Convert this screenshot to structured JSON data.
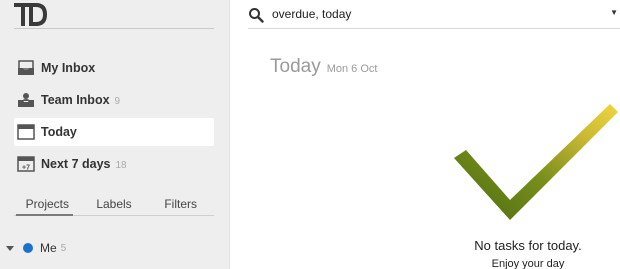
{
  "app": {
    "logo_text": "TD"
  },
  "sidebar": {
    "items": [
      {
        "label": "My Inbox",
        "count": "",
        "icon": "inbox-icon",
        "active": false
      },
      {
        "label": "Team Inbox",
        "count": "9",
        "icon": "team-inbox-icon",
        "active": false
      },
      {
        "label": "Today",
        "count": "",
        "icon": "calendar-icon",
        "active": true
      },
      {
        "label": "Next 7 days",
        "count": "18",
        "icon": "calendar-plus7-icon",
        "active": false
      }
    ],
    "tabs": [
      {
        "label": "Projects",
        "active": true
      },
      {
        "label": "Labels",
        "active": false
      },
      {
        "label": "Filters",
        "active": false
      }
    ],
    "projects": [
      {
        "label": "Me",
        "count": "5",
        "color": "#1a73c9"
      }
    ]
  },
  "search": {
    "value": "overdue, today"
  },
  "main": {
    "title": "Today",
    "date": "Mon 6 Oct",
    "empty_title": "No tasks for today.",
    "empty_subtitle": "Enjoy your day"
  },
  "colors": {
    "sidebar_bg": "#eeeeee",
    "check_dark": "#4a6b10",
    "check_light": "#f0d640",
    "project_dot": "#1a73c9"
  }
}
